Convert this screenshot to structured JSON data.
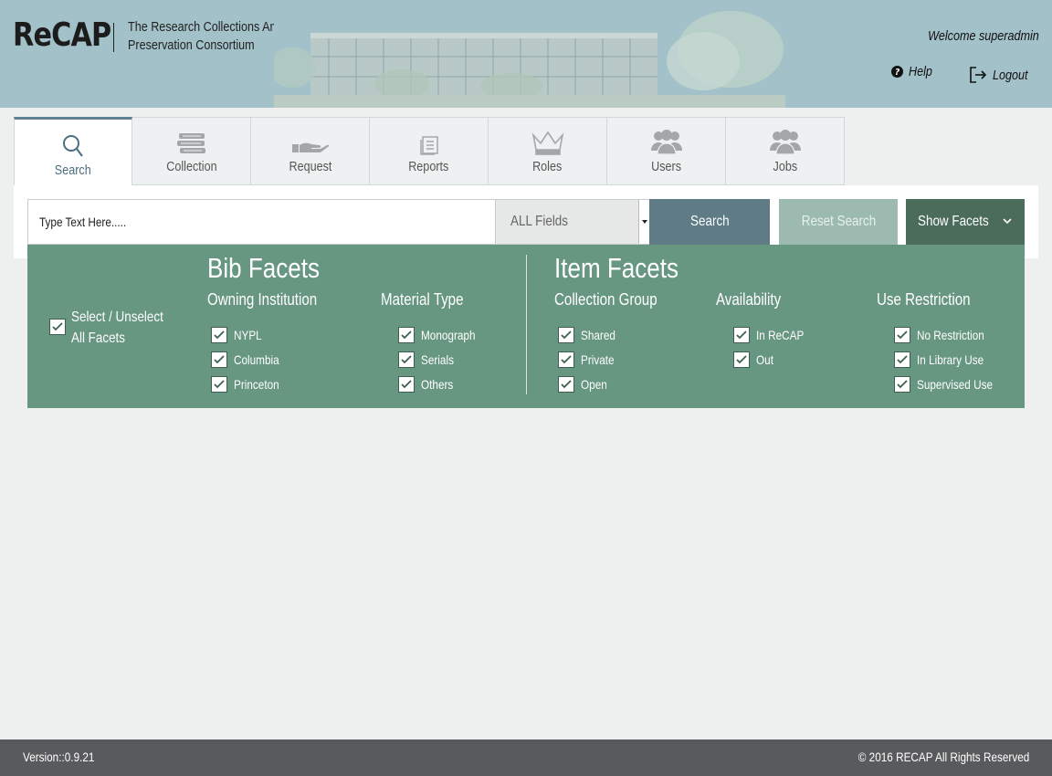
{
  "header": {
    "logo": "ReCAP",
    "tagline_line1": "The Research Collections And",
    "tagline_line2": "Preservation Consortium",
    "welcome": "Welcome superadmin",
    "help_label": "Help",
    "logout_label": "Logout"
  },
  "tabs": [
    {
      "label": "Search",
      "icon": "search-icon",
      "active": true
    },
    {
      "label": "Collection",
      "icon": "books-icon"
    },
    {
      "label": "Request",
      "icon": "hand-request-icon"
    },
    {
      "label": "Reports",
      "icon": "document-icon"
    },
    {
      "label": "Roles",
      "icon": "crown-icon"
    },
    {
      "label": "Users",
      "icon": "users-icon"
    },
    {
      "label": "Jobs",
      "icon": "users-group-icon"
    }
  ],
  "search": {
    "placeholder": "Type Text Here.....",
    "field_select": "ALL Fields",
    "search_button": "Search",
    "reset_button": "Reset Search",
    "facets_button": "Show Facets"
  },
  "facets": {
    "select_all_line1": "Select / Unselect",
    "select_all_line2": "All Facets",
    "bib_title": "Bib Facets",
    "item_title": "Item Facets",
    "owning_institution": {
      "title": "Owning Institution",
      "items": [
        "NYPL",
        "Columbia",
        "Princeton"
      ]
    },
    "material_type": {
      "title": "Material Type",
      "items": [
        "Monograph",
        "Serials",
        "Others"
      ]
    },
    "collection_group": {
      "title": "Collection Group",
      "items": [
        "Shared",
        "Private",
        "Open"
      ]
    },
    "availability": {
      "title": "Availability",
      "items": [
        "In ReCAP",
        "Out"
      ]
    },
    "use_restriction": {
      "title": "Use Restriction",
      "items": [
        "No Restriction",
        "In Library Use",
        "Supervised Use"
      ]
    }
  },
  "footer": {
    "version": "Version::0.9.21",
    "copyright": "© 2016 RECAP All Rights Reserved"
  }
}
